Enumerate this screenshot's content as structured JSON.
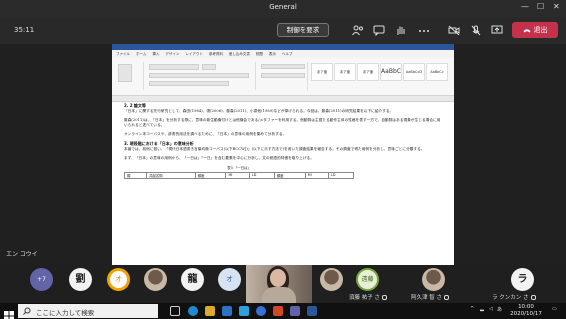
{
  "window": {
    "title": "General"
  },
  "toolbar": {
    "timer": "35:11",
    "request_control_label": "制御を要求",
    "leave_label": "退出",
    "colors": {
      "leave": "#c4314b",
      "background": "#292929"
    }
  },
  "shared_screen": {
    "sharer": "エン コウイ",
    "ribbon_tabs": [
      "ファイル",
      "ホーム",
      "挿入",
      "デザイン",
      "レイアウト",
      "参考資料",
      "差し込み文書",
      "校閲",
      "表示",
      "ヘルプ"
    ],
    "styles": [
      "あア亜",
      "あア亜",
      "あア亜",
      "AaBbC",
      "AaBbCcD",
      "AaBbCc"
    ],
    "document": {
      "heading_1": "2. 2 論文等",
      "para_1": "「日本」に関する先行研究として、森田(1984)、張(2006)、藤森(2011)、小泉他(1989)などが挙げられる。今回は、藤森(2011)の研究結果を以下に紹介する。",
      "para_2": "藤森(2011)は、「日本」を分析する際に、意味の新生動機付けとは他機会である/メタファーを利用する。他動詞は主語たる動作主体の性格を表す一方で、自動詞はある現象が生じる場合に用いられると述べている。",
      "para_3": "オンライン本コーパスや、辞書的用法を調べるために、「日本」の意味の用例を集めて分析する。",
      "heading_2": "3. 現段階における「日本」の意味分析",
      "para_4": "本論では、前例に倣い、「現代日本語書き言葉均衡コーパス(以下BCCWJ)」(以下に示す方法で)を用いた調査結果を報告する。その調査で得た用例を分析し、意味ごとに分類する。",
      "para_5": "まず、「日本」の意味の用例から、「一日は」「一日」を含む要素を中心に分析し、文の統語的特徴を取り上げる。",
      "table_caption": "表3 「一日は」",
      "table_headers": [
        "順",
        "共起名詞",
        "頻度",
        "MI",
        "LD",
        "頻度",
        "MI",
        "LD"
      ]
    }
  },
  "participants": {
    "more_count": "+7",
    "avatars": [
      {
        "kind": "ink",
        "text": "劉"
      },
      {
        "kind": "orange",
        "text": "オ"
      },
      {
        "kind": "ink",
        "text": "龍"
      },
      {
        "kind": "blue",
        "text": "オ"
      },
      {
        "kind": "green",
        "text": "遠藤"
      },
      {
        "kind": "ink",
        "text": "ラ"
      }
    ],
    "names": [
      "須藤 祐子 さ",
      "阿久津 智 さ",
      "ラ クンカン さ"
    ]
  },
  "taskbar": {
    "search_placeholder": "ここに入力して検索",
    "time": "10:00",
    "date": "2020/10/17",
    "tray_text": "あ"
  }
}
